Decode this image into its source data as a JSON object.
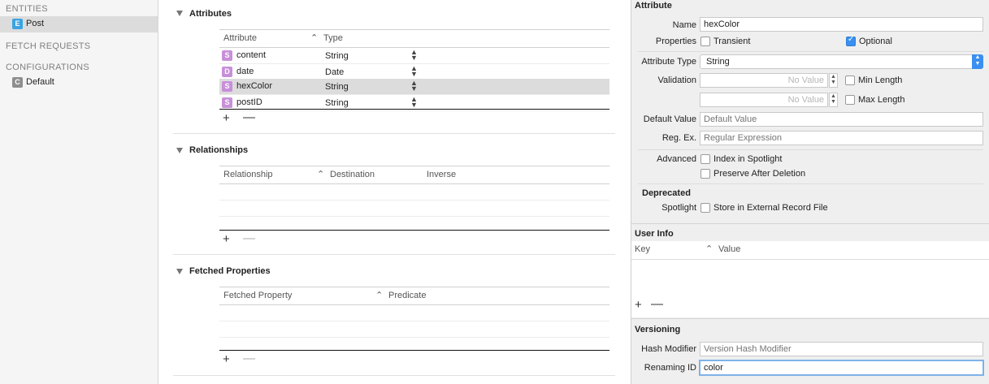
{
  "sidebar": {
    "entities_heading": "ENTITIES",
    "entities": [
      {
        "badge": "E",
        "label": "Post",
        "color": "#3aa3e3"
      }
    ],
    "fetch_heading": "FETCH REQUESTS",
    "config_heading": "CONFIGURATIONS",
    "configurations": [
      {
        "badge": "C",
        "label": "Default",
        "color": "#8e8e8e"
      }
    ]
  },
  "attributes": {
    "title": "Attributes",
    "col_attribute": "Attribute",
    "col_type": "Type",
    "rows": [
      {
        "badge": "S",
        "name": "content",
        "type": "String"
      },
      {
        "badge": "D",
        "name": "date",
        "type": "Date"
      },
      {
        "badge": "S",
        "name": "hexColor",
        "type": "String"
      },
      {
        "badge": "S",
        "name": "postID",
        "type": "String"
      }
    ],
    "add": "+",
    "remove": "—"
  },
  "relationships": {
    "title": "Relationships",
    "col_relationship": "Relationship",
    "col_destination": "Destination",
    "col_inverse": "Inverse",
    "add": "+",
    "remove": "—"
  },
  "fetched": {
    "title": "Fetched Properties",
    "col_property": "Fetched Property",
    "col_predicate": "Predicate",
    "add": "+",
    "remove": "—"
  },
  "inspector": {
    "attribute_heading": "Attribute",
    "name_label": "Name",
    "name_value": "hexColor",
    "properties_label": "Properties",
    "transient_label": "Transient",
    "optional_label": "Optional",
    "attr_type_label": "Attribute Type",
    "attr_type_value": "String",
    "validation_label": "Validation",
    "no_value": "No Value",
    "min_length_label": "Min Length",
    "max_length_label": "Max Length",
    "default_label": "Default Value",
    "default_placeholder": "Default Value",
    "regex_label": "Reg. Ex.",
    "regex_placeholder": "Regular Expression",
    "advanced_label": "Advanced",
    "index_label": "Index in Spotlight",
    "preserve_label": "Preserve After Deletion",
    "deprecated_label": "Deprecated",
    "spotlight_label": "Spotlight",
    "store_label": "Store in External Record File",
    "userinfo_heading": "User Info",
    "col_key": "Key",
    "col_value": "Value",
    "add": "+",
    "remove": "—",
    "versioning_heading": "Versioning",
    "hash_label": "Hash Modifier",
    "hash_placeholder": "Version Hash Modifier",
    "renaming_label": "Renaming ID",
    "renaming_value": "color"
  },
  "colors": {
    "accent": "#3a8ff0",
    "attr_badge": "#c88fd9",
    "selection": "#dcdcdc"
  }
}
